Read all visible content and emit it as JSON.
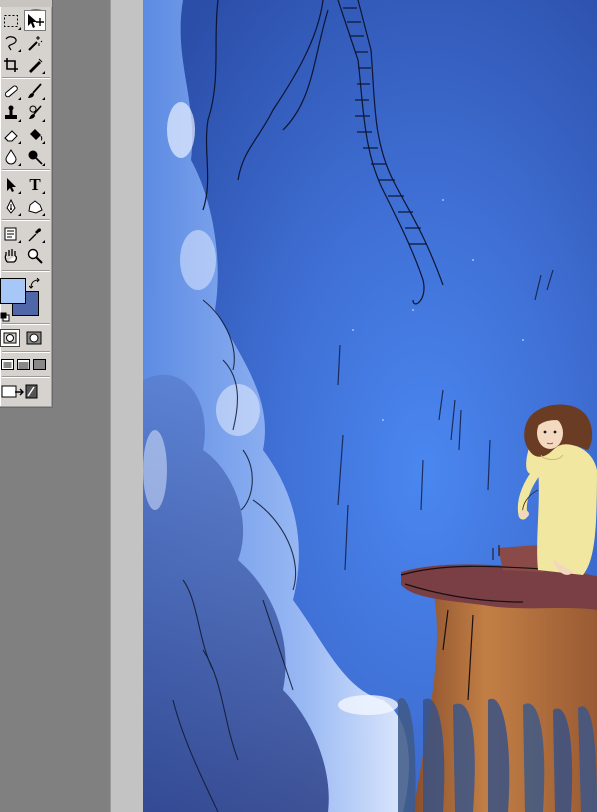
{
  "toolbox": {
    "tools": [
      {
        "name": "marquee-tool",
        "icon": "marquee-icon"
      },
      {
        "name": "move-tool",
        "icon": "move-icon",
        "selected": true
      },
      {
        "name": "lasso-tool",
        "icon": "lasso-icon"
      },
      {
        "name": "magic-wand-tool",
        "icon": "magic-wand-icon"
      },
      {
        "name": "crop-tool",
        "icon": "crop-icon"
      },
      {
        "name": "slice-tool",
        "icon": "slice-icon"
      },
      {
        "name": "healing-brush-tool",
        "icon": "bandage-icon"
      },
      {
        "name": "brush-tool",
        "icon": "brush-icon"
      },
      {
        "name": "clone-stamp-tool",
        "icon": "stamp-icon"
      },
      {
        "name": "history-brush-tool",
        "icon": "history-brush-icon"
      },
      {
        "name": "eraser-tool",
        "icon": "eraser-icon"
      },
      {
        "name": "paint-bucket-tool",
        "icon": "paint-bucket-icon"
      },
      {
        "name": "blur-tool",
        "icon": "blur-drop-icon"
      },
      {
        "name": "dodge-tool",
        "icon": "dodge-icon"
      },
      {
        "name": "path-selection-tool",
        "icon": "arrow-icon"
      },
      {
        "name": "type-tool",
        "icon": "type-icon"
      },
      {
        "name": "pen-tool",
        "icon": "pen-icon"
      },
      {
        "name": "custom-shape-tool",
        "icon": "shape-icon"
      },
      {
        "name": "notes-tool",
        "icon": "notes-icon"
      },
      {
        "name": "eyedropper-tool",
        "icon": "eyedropper-icon"
      },
      {
        "name": "hand-tool",
        "icon": "hand-icon"
      },
      {
        "name": "zoom-tool",
        "icon": "zoom-icon"
      }
    ],
    "type_glyph": "T",
    "foreground_color": "#a7c8f7",
    "background_color": "#4f67a8",
    "modes": [
      "standard-mode",
      "quick-mask-mode"
    ],
    "screen_modes": [
      "standard-screen-mode",
      "full-screen-menu-mode",
      "full-screen-mode"
    ],
    "jump_to": "jump-to-imageready"
  },
  "canvas": {
    "sky_color_top": "#3f6fd4",
    "sky_color_bottom": "#2f55b3",
    "cloud_color": "#c9dcff",
    "cliff_color": "#a86a3c",
    "cliff_top_color": "#7a3f45",
    "dress_color": "#f1e7a1",
    "hair_color": "#6b3c24"
  }
}
